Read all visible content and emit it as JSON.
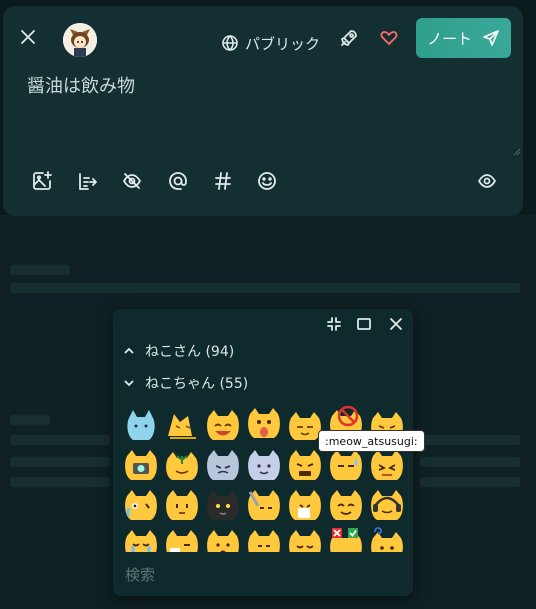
{
  "composer": {
    "visibility_label": "パブリック",
    "post_label": "ノート",
    "text": "醤油は飲み物"
  },
  "picker": {
    "categories": [
      {
        "label": "ねこさん (94)",
        "state": "collapsed"
      },
      {
        "label": "ねこちゃん (55)",
        "state": "expanded"
      }
    ],
    "tooltip": ":meow_atsusugi:",
    "search_placeholder": "検索"
  },
  "colors": {
    "accent": "#35a595",
    "like": "#ff6b6b",
    "emoji_yellow": "#ffc83d"
  },
  "icons": [
    "close-icon",
    "globe-icon",
    "rocket-icon",
    "heart-icon",
    "send-icon",
    "image-add-icon",
    "poll-icon",
    "eye-off-icon",
    "mention-icon",
    "hashtag-icon",
    "emoji-icon",
    "preview-eye-icon",
    "minimize-icon",
    "maximize-icon",
    "chevron-up-icon",
    "chevron-down-icon"
  ]
}
